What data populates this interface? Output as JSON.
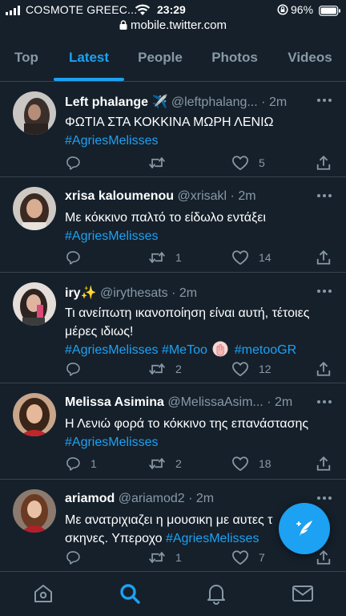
{
  "status_bar": {
    "carrier": "COSMOTE GREEC...",
    "time": "23:29",
    "battery": "96%",
    "url": "mobile.twitter.com"
  },
  "tabs": [
    {
      "label": "Top",
      "active": false
    },
    {
      "label": "Latest",
      "active": true
    },
    {
      "label": "People",
      "active": false
    },
    {
      "label": "Photos",
      "active": false
    },
    {
      "label": "Videos",
      "active": false
    }
  ],
  "tweets": [
    {
      "name": "Left phalange ✈️",
      "handle": "@leftphalang...",
      "dot": "·",
      "time": "2m",
      "line1": "ΦΩΤΙΑ ΣΤΑ ΚΟΚΚΙΝΑ ΜΩΡΗ ΛΕΝΙΩ",
      "hashtag": "#AgriesMelisses",
      "reply": "",
      "retweet": "",
      "like": "5"
    },
    {
      "name": "xrisa kaloumenou",
      "handle": "@xrisakl",
      "dot": "·",
      "time": "2m",
      "line1": "Με κόκκινο παλτό το είδωλο εντάξει",
      "hashtag": "#AgriesMelisses",
      "reply": "",
      "retweet": "1",
      "like": "14"
    },
    {
      "name": "iry✨",
      "handle": "@irythesats",
      "dot": "·",
      "time": "2m",
      "line1": "Τι ανείπωτη ικανοποίηση είναι αυτή, τέτοιες",
      "line2": "μέρες ιδιως!",
      "hashtag": "#AgriesMelisses",
      "hashtag2": "#MeToo",
      "hashtag3": "#metooGR",
      "reply": "",
      "retweet": "2",
      "like": "12"
    },
    {
      "name": "Melissa Asimina",
      "handle": "@MelissaAsim...",
      "dot": "·",
      "time": "2m",
      "line1": "Η Λενιώ φορά το κόκκινο της επανάστασης",
      "hashtag": "#AgriesMelisses",
      "reply": "1",
      "retweet": "2",
      "like": "18"
    },
    {
      "name": "ariamod",
      "handle": "@ariamod2",
      "dot": "·",
      "time": "2m",
      "line1": "Με ανατριχιαζει η μουσικη με αυτες τ",
      "line2": "σκηνες. Υπεροχο",
      "hashtag": "#AgriesMelisses",
      "reply": "",
      "retweet": "1",
      "like": "7"
    }
  ],
  "icons": {
    "home": "home-icon",
    "search": "search-icon",
    "notifications": "bell-icon",
    "messages": "mail-icon",
    "compose": "compose-tweet-icon"
  },
  "colors": {
    "background": "#15202b",
    "accent": "#1da1f2",
    "secondary_text": "#8899a6",
    "divider": "#38444d"
  }
}
